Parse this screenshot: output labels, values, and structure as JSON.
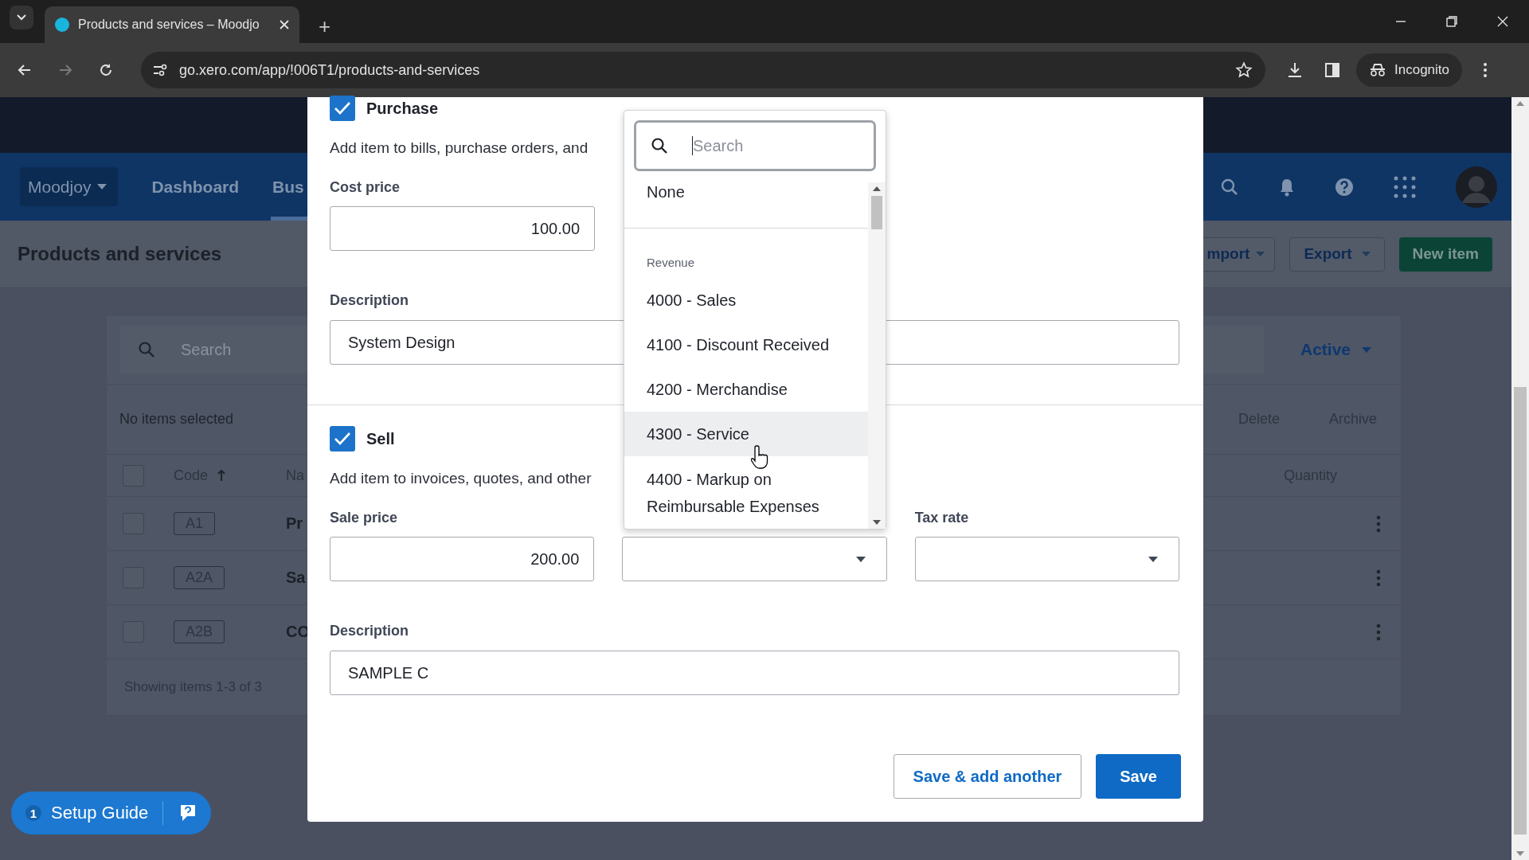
{
  "browser": {
    "tab_title": "Products and services – Moodjo",
    "new_tab": "+",
    "url": "go.xero.com/app/!006T1/products-and-services",
    "profile": "Incognito"
  },
  "nav": {
    "org": "Moodjoy",
    "tabs": [
      {
        "label": "Dashboard",
        "selected": false
      },
      {
        "label": "Bus",
        "selected": true
      }
    ]
  },
  "page": {
    "title": "Products and services",
    "actions": [
      "mport",
      "Export"
    ],
    "primary": "New item"
  },
  "list": {
    "search_placeholder": "Search",
    "filter": "Active",
    "selection": "No items selected",
    "bulk_actions": [
      "Delete",
      "Archive"
    ],
    "columns": [
      "Code",
      "Na",
      "Quantity"
    ],
    "all_checked": false,
    "rows": [
      {
        "code": "A1",
        "name": "Pr",
        "checked": false
      },
      {
        "code": "A2A",
        "name": "Sa",
        "checked": false
      },
      {
        "code": "A2B",
        "name": "CO",
        "checked": false
      }
    ],
    "footer": "Showing items 1-3 of 3"
  },
  "modal": {
    "sections": [
      {
        "label": "Purchase",
        "checked": true,
        "hint": "Add item to bills, purchase orders, and",
        "price_label": "Cost price",
        "price": "100.00",
        "description_label": "Description",
        "description": "System Design"
      },
      {
        "label": "Sell",
        "checked": true,
        "hint": "Add item to invoices, quotes, and other",
        "price_label": "Sale price",
        "price": "200.00",
        "tax_label": "Tax rate",
        "description_label": "Description",
        "description": "SAMPLE C"
      }
    ],
    "buttons": [
      {
        "label": "Save & add another",
        "kind": "secondary"
      },
      {
        "label": "Save",
        "kind": "primary"
      }
    ]
  },
  "account_dropdown": {
    "placeholder": "Search",
    "items": [
      {
        "kind": "option",
        "label": "None",
        "highlighted": false
      },
      {
        "kind": "group",
        "label": "Revenue"
      },
      {
        "kind": "option",
        "label": "4000 - Sales",
        "highlighted": false
      },
      {
        "kind": "option",
        "label": "4100 - Discount Received",
        "highlighted": false
      },
      {
        "kind": "option",
        "label": "4200 - Merchandise",
        "highlighted": false
      },
      {
        "kind": "option",
        "label": "4300 - Service",
        "highlighted": true
      },
      {
        "kind": "option",
        "label": "4400 - Markup on Reimbursable Expenses",
        "highlighted": false
      }
    ]
  },
  "setup_guide": {
    "count": "1",
    "label": "Setup Guide"
  }
}
